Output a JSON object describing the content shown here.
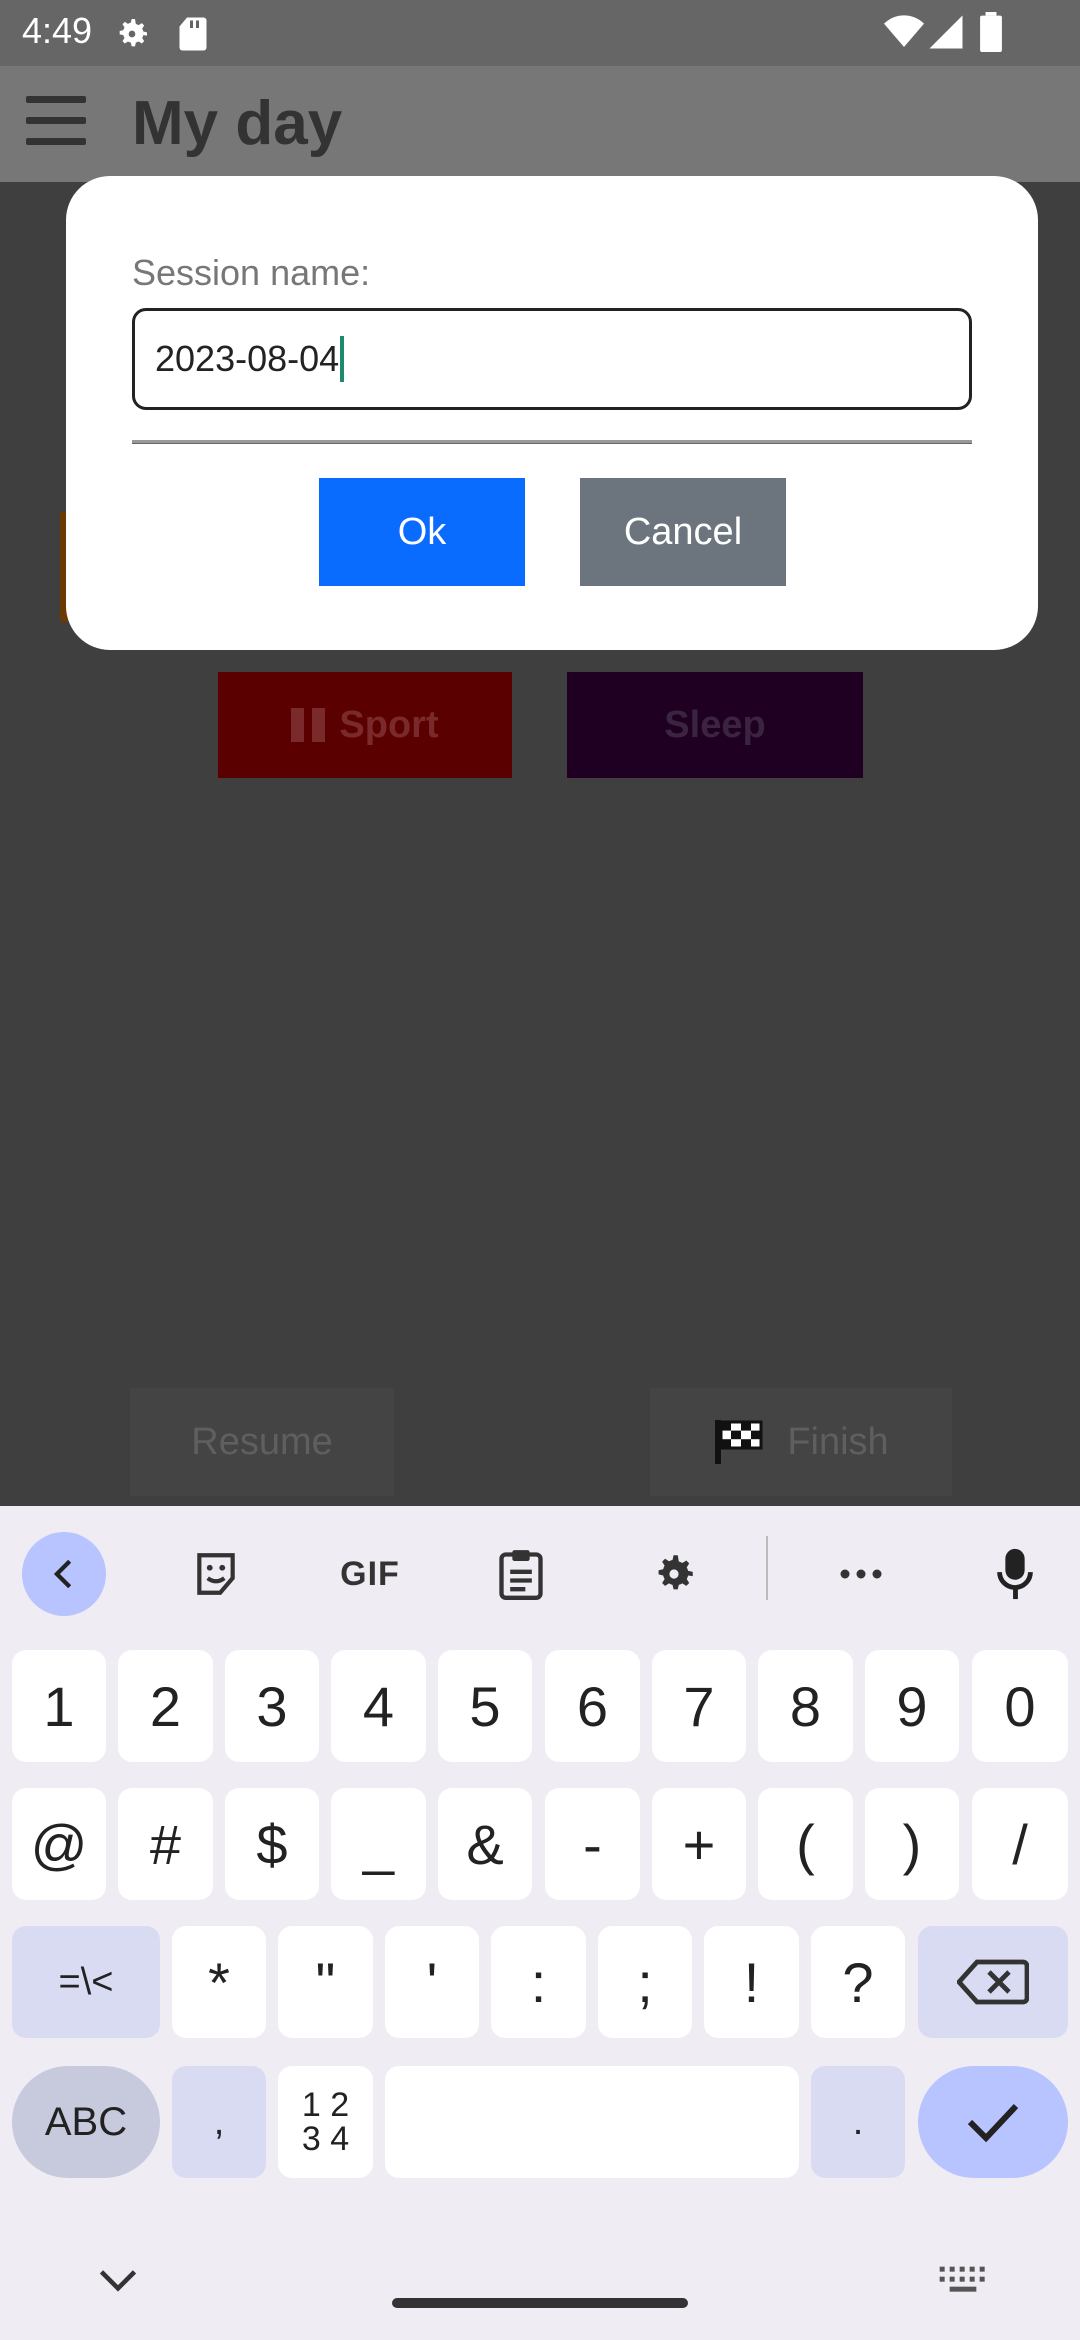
{
  "status_bar": {
    "time": "4:49",
    "icons": [
      "settings-gear-icon",
      "sd-card-icon",
      "wifi-icon",
      "cell-signal-icon",
      "battery-icon"
    ]
  },
  "app_bar": {
    "title": "My day",
    "menu_icon": "hamburger-menu-icon"
  },
  "background": {
    "sport_label": "Sport",
    "sleep_label": "Sleep",
    "resume_label": "Resume",
    "finish_label": "Finish"
  },
  "dialog": {
    "label": "Session name:",
    "input_value": "2023-08-04",
    "ok_label": "Ok",
    "cancel_label": "Cancel"
  },
  "keyboard": {
    "toolbar": {
      "gif_label": "GIF",
      "icons": [
        "back-chevron-icon",
        "sticker-icon",
        "gif-icon",
        "clipboard-icon",
        "settings-icon",
        "more-icon",
        "microphone-icon"
      ]
    },
    "row1": [
      "1",
      "2",
      "3",
      "4",
      "5",
      "6",
      "7",
      "8",
      "9",
      "0"
    ],
    "row2": [
      "@",
      "#",
      "$",
      "_",
      "&",
      "-",
      "+",
      "(",
      ")",
      "/"
    ],
    "row3": [
      "=\\<",
      "*",
      "\"",
      "'",
      ":",
      ";",
      "!",
      "?"
    ],
    "row4": {
      "abc": "ABC",
      "comma": ",",
      "numpad_top": "1 2",
      "numpad_bottom": "3 4",
      "period": "."
    }
  },
  "colors": {
    "ok_button": "#0a6cff",
    "cancel_button": "#6c757d",
    "sport_button": "#5a0000",
    "sleep_button": "#1f0022",
    "keyboard_accent": "#b8c4ff"
  }
}
